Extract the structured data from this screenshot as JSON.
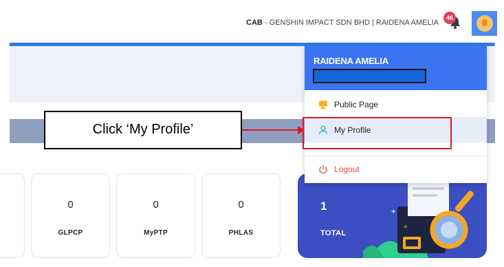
{
  "header": {
    "org_code": "CAB",
    "org_rest": " - GENSHIN IMPACT SDN BHD | RAIDENA AMELIA",
    "notification_count": "46"
  },
  "cards": [
    {
      "value": "0",
      "label": "GLPCP"
    },
    {
      "value": "0",
      "label": "MyPTP"
    },
    {
      "value": "0",
      "label": "PHLAS"
    }
  ],
  "total_card": {
    "value": "1",
    "label": "TOTAL"
  },
  "dropdown": {
    "user_name": "RAIDENA AMELIA",
    "items": [
      {
        "label": "Public Page",
        "icon": "monitor-icon"
      },
      {
        "label": "My Profile",
        "icon": "user-icon"
      },
      {
        "label": "Logout",
        "icon": "power-icon"
      }
    ]
  },
  "annotation": {
    "callout_text": "Click ‘My Profile’"
  },
  "colors": {
    "accent_blue": "#3b74f2",
    "total_card_bg": "#3b4fc3",
    "annotation_red": "#e01818",
    "logout_red": "#e04a3f"
  }
}
